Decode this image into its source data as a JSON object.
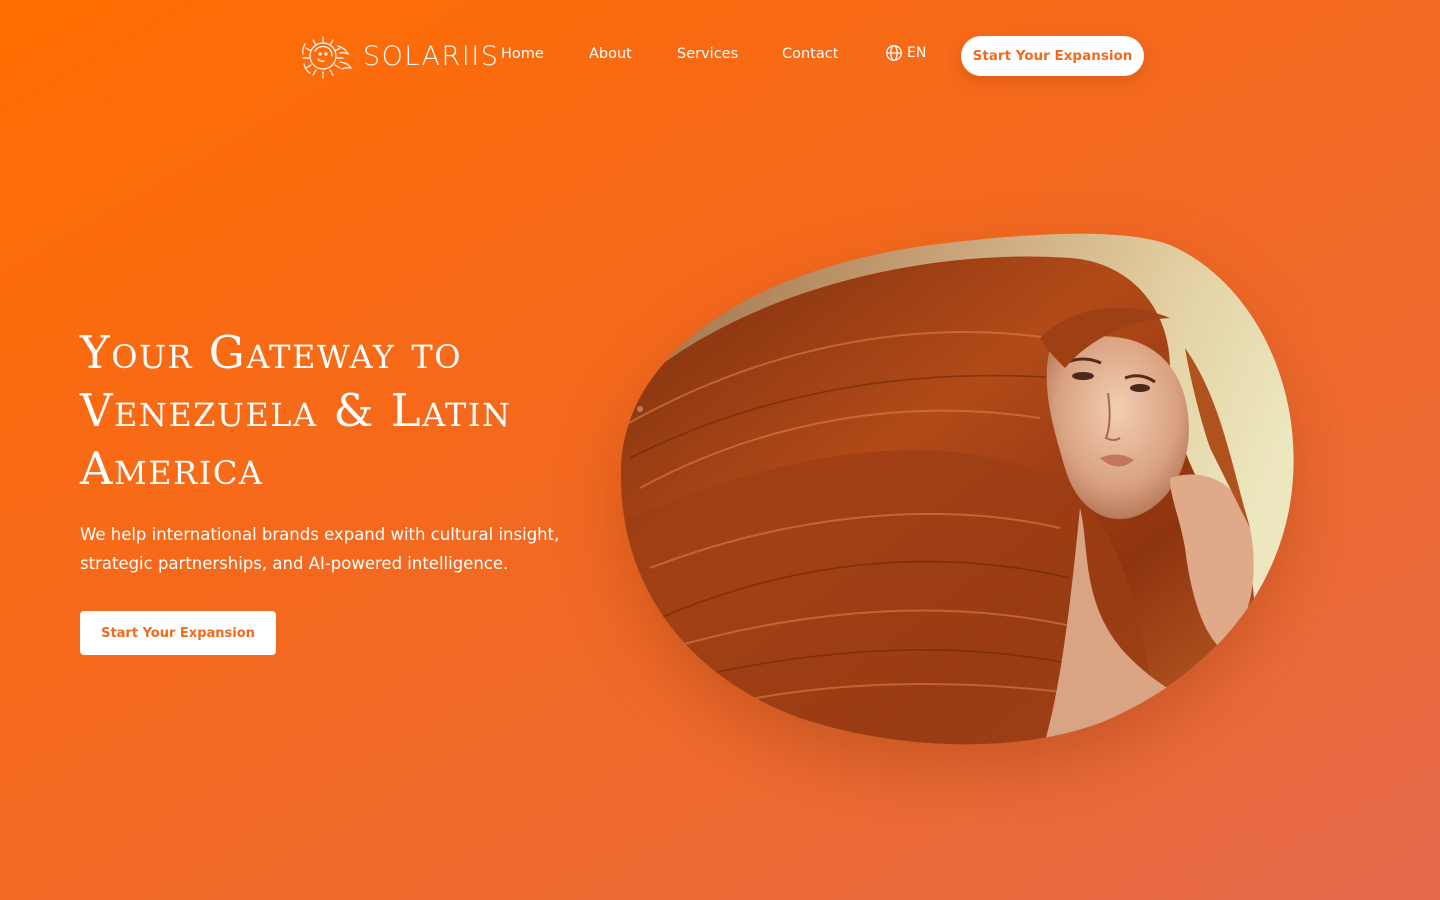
{
  "brand": {
    "name": "SOLARIIS",
    "logo_icon": "sun-woman-emblem-icon"
  },
  "nav": {
    "items": [
      {
        "label": "Home"
      },
      {
        "label": "About"
      },
      {
        "label": "Services"
      },
      {
        "label": "Contact"
      }
    ],
    "language": {
      "icon": "globe-icon",
      "label": "EN"
    },
    "cta_label": "Start Your Expansion"
  },
  "hero": {
    "title": "Your Gateway to Venezuela & Latin America",
    "subtitle": "We help international brands expand with cultural insight, strategic partnerships, and AI-powered intelligence.",
    "cta_label": "Start Your Expansion",
    "image_subject": "portrait of a woman with long flowing red hair"
  },
  "colors": {
    "background_start": "#ff6d00",
    "background_end": "#e6694d",
    "accent_text": "#f26a1b",
    "button_bg": "#ffffff"
  }
}
